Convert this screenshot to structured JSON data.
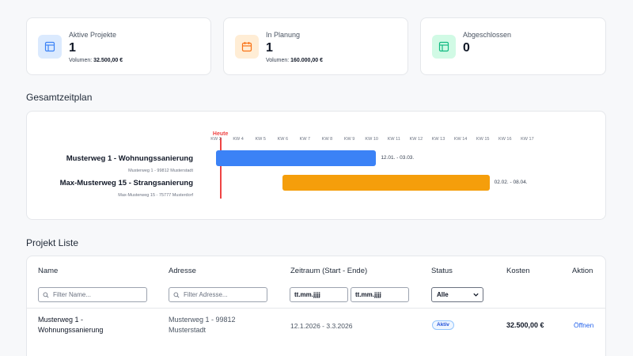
{
  "stats": [
    {
      "label": "Aktive Projekte",
      "value": "1",
      "volume_label": "Volumen:",
      "volume_value": "32.500,00 €",
      "icon": "folder-icon",
      "color": "#3b82f6",
      "bg": "#dbeafe"
    },
    {
      "label": "In Planung",
      "value": "1",
      "volume_label": "Volumen:",
      "volume_value": "160.000,00 €",
      "icon": "calendar-icon",
      "color": "#f97316",
      "bg": "#ffedd5"
    },
    {
      "label": "Abgeschlossen",
      "value": "0",
      "icon": "archive-icon",
      "color": "#10b981",
      "bg": "#d1fae5"
    }
  ],
  "timeline": {
    "title": "Gesamtzeitplan",
    "today_label": "Heute",
    "weeks": [
      "KW 3",
      "KW 4",
      "KW 5",
      "KW 6",
      "KW 7",
      "KW 8",
      "KW 9",
      "KW 10",
      "KW 11",
      "KW 12",
      "KW 13",
      "KW 14",
      "KW 15",
      "KW 16",
      "KW 17"
    ],
    "today_week": 3.2,
    "projects": [
      {
        "name": "Musterweg 1 - Wohnungssanierung",
        "address": "Musterweg 1 - 99812 Musterstadt",
        "range": "12.01. - 03.03.",
        "start_week": 3.0,
        "end_week": 10.2,
        "color": "#3b82f6"
      },
      {
        "name": "Max-Musterweg 15 - Strangsanierung",
        "address": "Max-Musterweg 15 - 75777 Musterdorf",
        "range": "02.02. - 08.04.",
        "start_week": 6.0,
        "end_week": 15.3,
        "color": "#f59e0b"
      }
    ]
  },
  "list": {
    "title": "Projekt Liste",
    "columns": {
      "name": "Name",
      "address": "Adresse",
      "period": "Zeitraum (Start - Ende)",
      "status": "Status",
      "cost": "Kosten",
      "action": "Aktion"
    },
    "filters": {
      "name_placeholder": "Filter Name...",
      "address_placeholder": "Filter Adresse...",
      "date_from": "tt.mm.jjjj",
      "date_to": "tt.mm.jjjj",
      "status_selected": "Alle"
    },
    "rows": [
      {
        "name_line1": "Musterweg 1 -",
        "name_line2": "Wohnungssanierung",
        "address_line1": "Musterweg 1 - 99812",
        "address_line2": "Musterstadt",
        "period": "12.1.2026 - 3.3.2026",
        "status": "Aktiv",
        "cost": "32.500,00 €",
        "action": "Öffnen"
      }
    ]
  }
}
